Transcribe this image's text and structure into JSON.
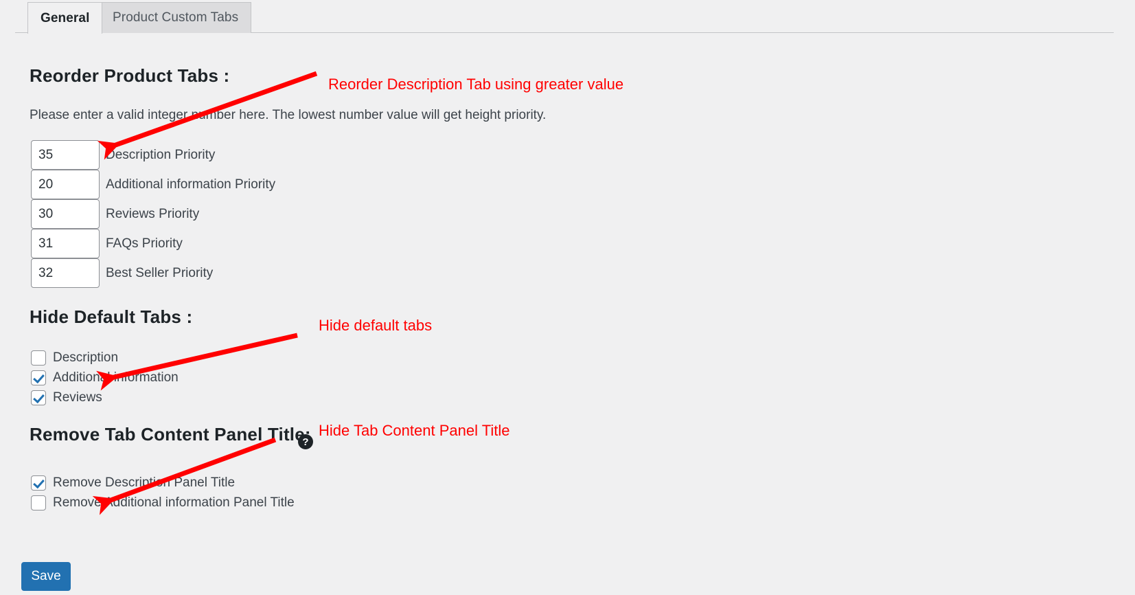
{
  "page": {
    "background_color": "#f0f0f1",
    "accent_color": "#2271b1",
    "annotation_color": "#ff0000"
  },
  "tabs": [
    {
      "label": "General",
      "active": true
    },
    {
      "label": "Product Custom Tabs",
      "active": false
    }
  ],
  "reorder_section": {
    "title": "Reorder Product Tabs :",
    "helper_text": "Please enter a valid integer number here. The lowest number value will get height priority.",
    "fields": [
      {
        "value": "35",
        "label": "Description Priority",
        "placeholder": ""
      },
      {
        "value": "20",
        "label": "Additional information Priority",
        "placeholder": ""
      },
      {
        "value": "30",
        "label": "Reviews Priority",
        "placeholder": ""
      },
      {
        "value": "31",
        "label": "FAQs Priority",
        "placeholder": ""
      },
      {
        "value": "32",
        "label": "Best Seller Priority",
        "placeholder": ""
      }
    ]
  },
  "hide_default_tabs_section": {
    "title": "Hide Default Tabs :",
    "options": [
      {
        "label": "Description",
        "checked": false
      },
      {
        "label": "Additional information",
        "checked": true
      },
      {
        "label": "Reviews",
        "checked": true
      }
    ]
  },
  "remove_panel_title_section": {
    "title": "Remove Tab Content Panel Title:",
    "help_icon": "help-icon",
    "help_glyph": "?",
    "options": [
      {
        "label": "Remove Description Panel Title",
        "checked": true
      },
      {
        "label": "Remove Additional information Panel Title",
        "checked": false
      }
    ]
  },
  "footer": {
    "save_label": "Save"
  },
  "annotations": [
    {
      "text": "Reorder Description Tab using greater value"
    },
    {
      "text": "Hide default tabs"
    },
    {
      "text": "Hide Tab Content Panel Title"
    }
  ]
}
